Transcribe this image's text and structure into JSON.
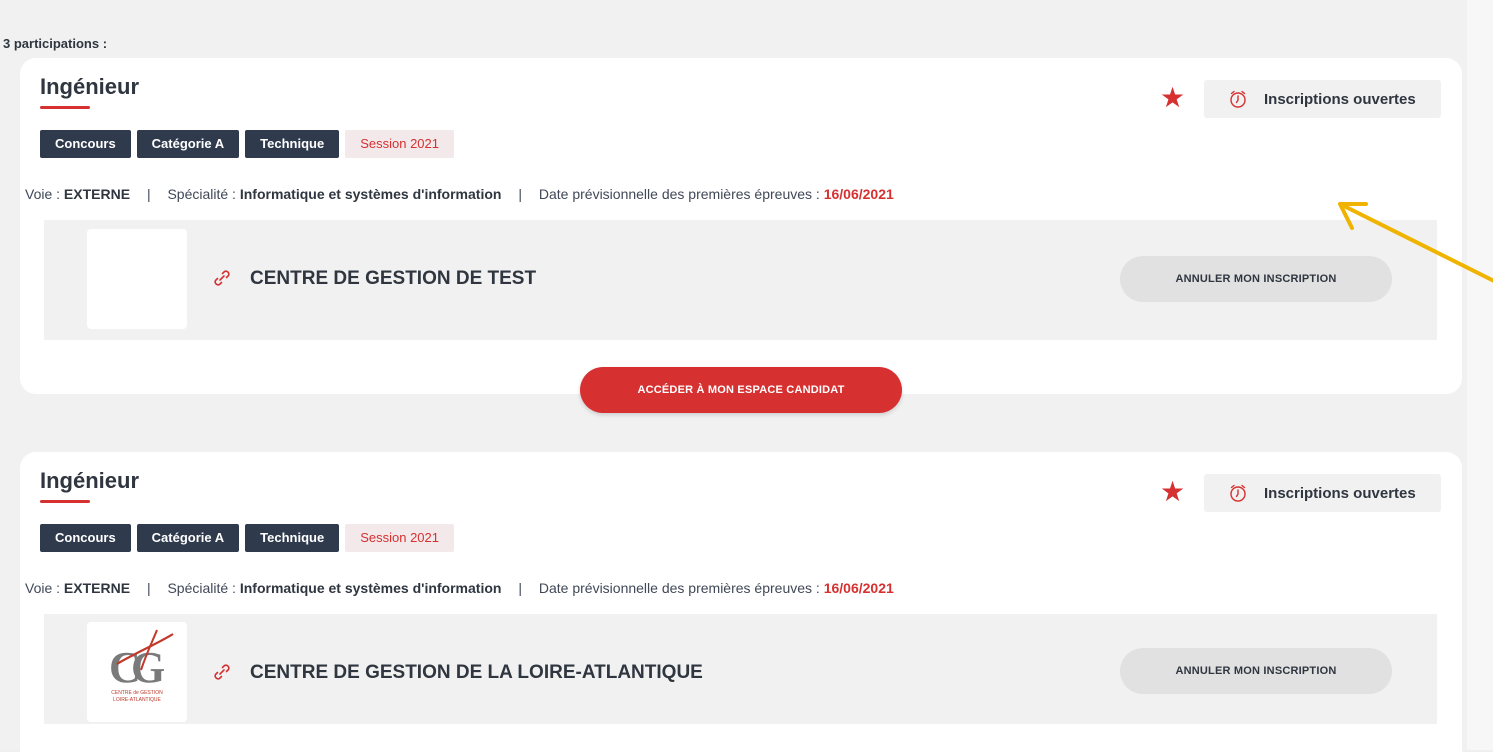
{
  "summary": {
    "count_label": "3 participations :"
  },
  "participations": [
    {
      "title": "Ingénieur",
      "status": "Inscriptions ouvertes",
      "tags": [
        "Concours",
        "Catégorie A",
        "Technique",
        "Session 2021"
      ],
      "voie_label": "Voie :",
      "voie_value": "EXTERNE",
      "specialite_label": "Spécialité :",
      "specialite_value": "Informatique et systèmes d'information",
      "date_label": "Date prévisionnelle des premières épreuves :",
      "date_value": "16/06/2021",
      "centre_name": "CENTRE DE GESTION DE TEST",
      "cancel_label": "ANNULER MON INSCRIPTION",
      "access_label": "ACCÉDER À MON ESPACE CANDIDAT"
    },
    {
      "title": "Ingénieur",
      "status": "Inscriptions ouvertes",
      "tags": [
        "Concours",
        "Catégorie A",
        "Technique",
        "Session 2021"
      ],
      "voie_label": "Voie :",
      "voie_value": "EXTERNE",
      "specialite_label": "Spécialité :",
      "specialite_value": "Informatique et systèmes d'information",
      "date_label": "Date prévisionnelle des premières épreuves :",
      "date_value": "16/06/2021",
      "centre_name": "CENTRE DE GESTION DE LA LOIRE-ATLANTIQUE",
      "cancel_label": "ANNULER MON INSCRIPTION",
      "logo_text_line1": "CENTRE de GESTION",
      "logo_text_line2": "LOIRE-ATLANTIQUE"
    }
  ],
  "colors": {
    "accent": "#d63031",
    "tag_dark": "#2f3a4d",
    "annotation_arrow": "#f0b400"
  },
  "icons": [
    "star-icon",
    "alarm-clock-icon",
    "link-icon",
    "arrow-annotation-icon"
  ]
}
